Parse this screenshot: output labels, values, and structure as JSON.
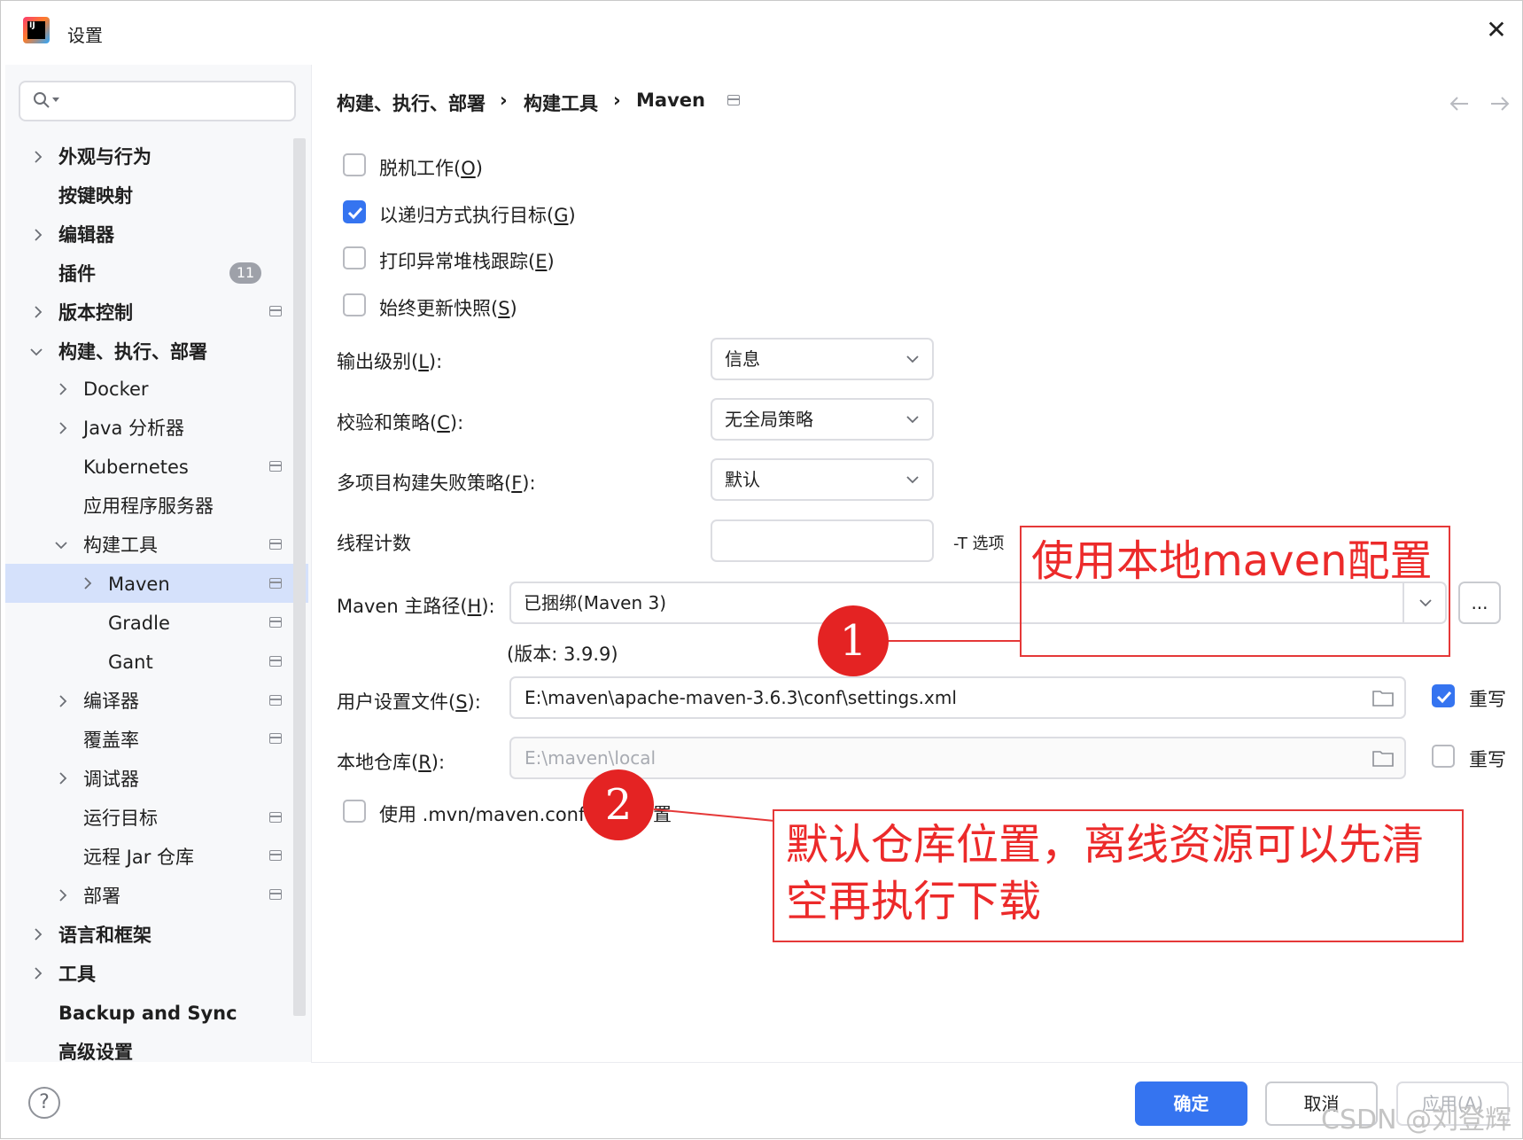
{
  "window": {
    "title": "设置"
  },
  "search": {
    "placeholder": ""
  },
  "sidebar": {
    "plugins_badge": "11",
    "items": [
      {
        "label": "外观与行为"
      },
      {
        "label": "按键映射"
      },
      {
        "label": "编辑器"
      },
      {
        "label": "插件"
      },
      {
        "label": "版本控制"
      },
      {
        "label": "构建、执行、部署"
      },
      {
        "label": "Docker"
      },
      {
        "label": "Java 分析器"
      },
      {
        "label": "Kubernetes"
      },
      {
        "label": "应用程序服务器"
      },
      {
        "label": "构建工具"
      },
      {
        "label": "Maven"
      },
      {
        "label": "Gradle"
      },
      {
        "label": "Gant"
      },
      {
        "label": "编译器"
      },
      {
        "label": "覆盖率"
      },
      {
        "label": "调试器"
      },
      {
        "label": "运行目标"
      },
      {
        "label": "远程 Jar 仓库"
      },
      {
        "label": "部署"
      },
      {
        "label": "语言和框架"
      },
      {
        "label": "工具"
      },
      {
        "label": "Backup and Sync"
      },
      {
        "label": "高级设置"
      }
    ]
  },
  "breadcrumb": {
    "part1": "构建、执行、部署",
    "part2": "构建工具",
    "part3": "Maven",
    "sep": "›"
  },
  "options": {
    "offline_pre": "脱机工作(",
    "offline_key": "O",
    "offline_post": ")",
    "recursive_pre": "以递归方式执行目标(",
    "recursive_key": "G",
    "recursive_post": ")",
    "stacktrace_pre": "打印异常堆栈跟踪(",
    "stacktrace_key": "E",
    "stacktrace_post": ")",
    "snapshots_pre": "始终更新快照(",
    "snapshots_key": "S",
    "snapshots_post": ")",
    "recursive_checked": true
  },
  "fields": {
    "output_level_pre": "输出级别(",
    "output_level_key": "L",
    "output_level_post": "):",
    "output_level_value": "信息",
    "checksum_pre": "校验和策略(",
    "checksum_key": "C",
    "checksum_post": "):",
    "checksum_value": "无全局策略",
    "multiproject_pre": "多项目构建失败策略(",
    "multiproject_key": "F",
    "multiproject_post": "):",
    "multiproject_value": "默认",
    "threads_label": "线程计数",
    "threads_value": "",
    "threads_hint": "-T 选项",
    "maven_home_pre": "Maven 主路径(",
    "maven_home_key": "H",
    "maven_home_post": "):",
    "maven_home_value": "已捆绑(Maven 3)",
    "browse_label": "...",
    "version_text": "(版本: 3.9.9)",
    "user_settings_pre": "用户设置文件(",
    "user_settings_key": "S",
    "user_settings_post": "):",
    "user_settings_value": "E:\\maven\\apache-maven-3.6.3\\conf\\settings.xml",
    "override_label": "重写",
    "local_repo_pre": "本地仓库(",
    "local_repo_key": "R",
    "local_repo_post": "):",
    "local_repo_value": "E:\\maven\\local",
    "use_mvn_config_left": "使用 .mvn/maven.confi",
    "use_mvn_config_right": "置"
  },
  "annotations": {
    "a1_number": "1",
    "a1_text": "使用本地maven配置",
    "a2_number": "2",
    "a2_line1": "默认仓库位置，离线资源可以先清",
    "a2_line2": "空再执行下载"
  },
  "footer": {
    "ok": "确定",
    "cancel": "取消",
    "apply": "应用(A)",
    "help": "?"
  },
  "watermark": "CSDN @刘登辉",
  "colors": {
    "accent": "#3574f0",
    "selection": "#d5e1fb",
    "annotation": "#e53838"
  }
}
